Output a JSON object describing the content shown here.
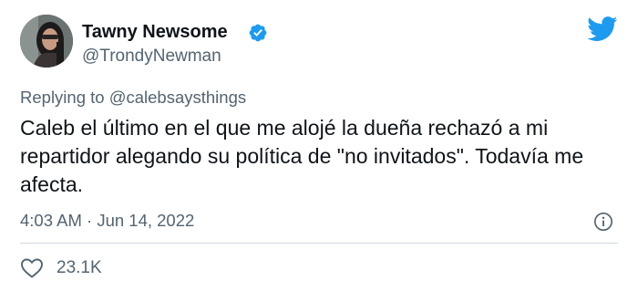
{
  "author": {
    "name": "Tawny Newsome",
    "handle": "@TrondyNewman",
    "verified": true
  },
  "reply": {
    "prefix": "Replying to",
    "mention": "@calebsaysthings"
  },
  "tweet": {
    "text": "Caleb el último en el que me alojé la dueña rechazó a mi repartidor alegando su política de \"no invitados\". Todavía me afecta.",
    "timestamp": "4:03 AM · Jun 14, 2022"
  },
  "stats": {
    "likes": "23.1K"
  },
  "colors": {
    "twitter_blue": "#1d9bf0",
    "text_primary": "#0f1419",
    "text_secondary": "#536471",
    "divider": "#cfd9de"
  },
  "icons": {
    "verified": "verified-badge-icon",
    "logo": "twitter-bird-icon",
    "info": "info-icon",
    "like": "heart-icon"
  }
}
